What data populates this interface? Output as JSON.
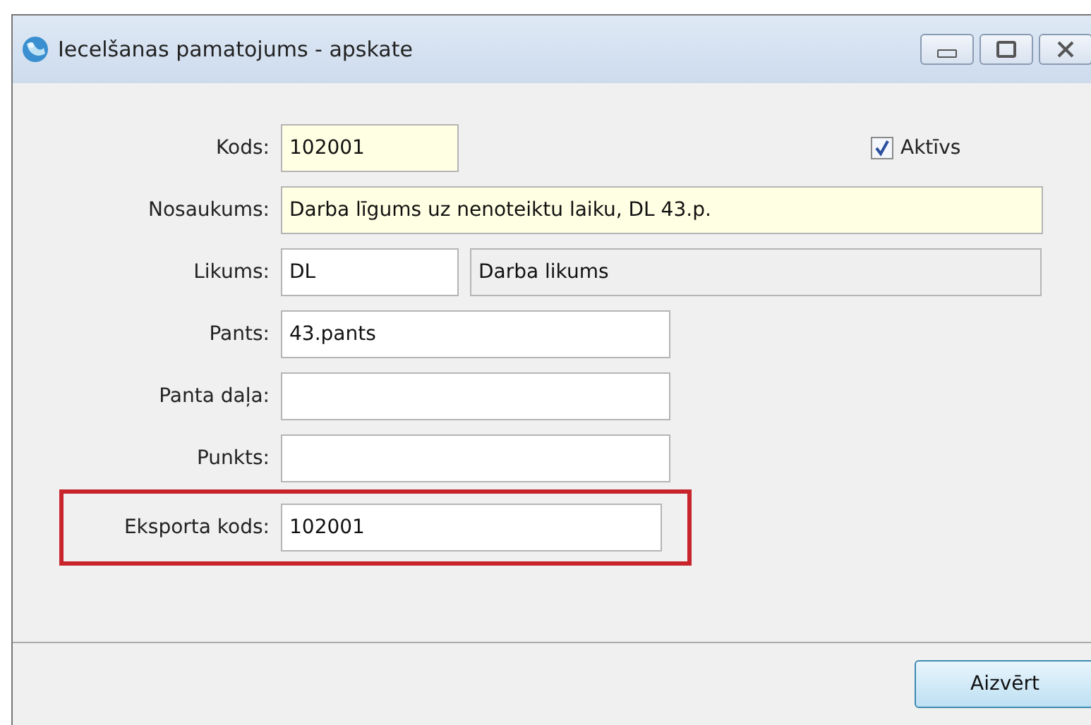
{
  "window": {
    "title": "Iecelšanas pamatojums - apskate"
  },
  "active": {
    "label": "Aktīvs",
    "checked": true
  },
  "rows": [
    {
      "label": "Kods:",
      "outlined": false,
      "fields": [
        {
          "value": "102001",
          "kind": "required"
        }
      ]
    },
    {
      "label": "Nosaukums:",
      "outlined": false,
      "fields": [
        {
          "value": "Darba līgums uz nenoteiktu laiku, DL 43.p.",
          "kind": "required"
        }
      ]
    },
    {
      "label": "Likums:",
      "outlined": false,
      "fields": [
        {
          "value": "DL",
          "kind": "normal"
        },
        {
          "value": "Darba likums",
          "kind": "readonly"
        }
      ]
    },
    {
      "label": "Pants:",
      "outlined": false,
      "fields": [
        {
          "value": "43.pants",
          "kind": "normal"
        }
      ]
    },
    {
      "label": "Panta daļa:",
      "outlined": false,
      "fields": [
        {
          "kind": "normal"
        }
      ]
    },
    {
      "label": "Punkts:",
      "outlined": false,
      "fields": [
        {
          "kind": "normal"
        }
      ]
    },
    {
      "label": "Eksporta kods:",
      "outlined": true,
      "fields": [
        {
          "value": "102001",
          "kind": "normal"
        }
      ]
    }
  ],
  "buttons": [
    "Aizvērt"
  ]
}
